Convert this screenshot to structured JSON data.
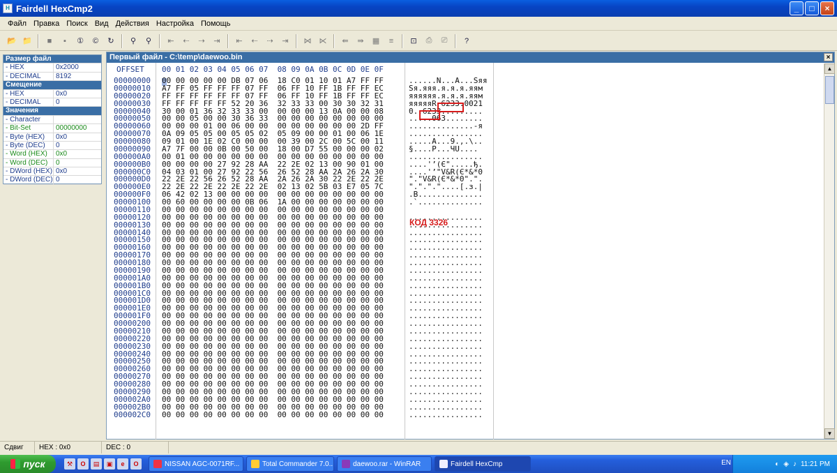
{
  "window": {
    "title": "Fairdell HexCmp2"
  },
  "menu": [
    "Файл",
    "Правка",
    "Поиск",
    "Вид",
    "Действия",
    "Настройка",
    "Помощь"
  ],
  "left_panel": [
    {
      "type": "header",
      "label": "Размер файл"
    },
    {
      "type": "row",
      "label": "- HEX",
      "value": "0x2000",
      "style": "blue"
    },
    {
      "type": "row",
      "label": "- DECIMAL",
      "value": "8192",
      "style": "blue"
    },
    {
      "type": "header",
      "label": "Смещение"
    },
    {
      "type": "row",
      "label": "- HEX",
      "value": "0x0",
      "style": "blue"
    },
    {
      "type": "row",
      "label": "- DECIMAL",
      "value": "0",
      "style": "blue"
    },
    {
      "type": "header",
      "label": "Значения"
    },
    {
      "type": "row",
      "label": "- Character",
      "value": "",
      "style": "blue"
    },
    {
      "type": "row",
      "label": "- Bit-Set",
      "value": "00000000",
      "style": "green"
    },
    {
      "type": "row",
      "label": "- Byte (HEX)",
      "value": "0x0",
      "style": "blue"
    },
    {
      "type": "row",
      "label": "- Byte (DEC)",
      "value": "0",
      "style": "blue"
    },
    {
      "type": "row",
      "label": "- Word (HEX)",
      "value": "0x0",
      "style": "green"
    },
    {
      "type": "row",
      "label": "- Word (DEC)",
      "value": "0",
      "style": "green"
    },
    {
      "type": "row",
      "label": "- DWord (HEX)",
      "value": "0x0",
      "style": "blue"
    },
    {
      "type": "row",
      "label": "- DWord (DEC)",
      "value": "0",
      "style": "blue"
    }
  ],
  "hex_panel": {
    "title": "Первый файл - C:\\temp\\daewoo.bin",
    "offset_header": "OFFSET",
    "column_header": "00 01 02 03 04 05 06 07  08 09 0A 0B 0C 0D 0E 0F",
    "rows": [
      {
        "o": "00000000",
        "h": "00 00 00 00 00 DB 07 06  18 C0 01 10 01 A7 FF FF",
        "a": "......N...A...Sяя"
      },
      {
        "o": "00000010",
        "h": "A7 FF 05 FF FF FF 07 FF  06 FF 10 FF 1B FF FF EC",
        "a": "Sя.яяя.я.я.я.яям"
      },
      {
        "o": "00000020",
        "h": "FF FF FF FF FF FF 07 FF  06 FF 10 FF 1B FF FF EC",
        "a": "яяяяяя.я.я.я.яям"
      },
      {
        "o": "00000030",
        "h": "FF FF FF FF FF 52 20 36  32 33 33 00 30 30 32 31",
        "a": "яяяяяR 6233.0021"
      },
      {
        "o": "00000040",
        "h": "30 00 01 36 32 33 33 00  00 00 00 13 0A 00 00 08",
        "a": "0..6233........."
      },
      {
        "o": "00000050",
        "h": "00 00 05 00 00 30 36 33  00 00 00 00 00 00 00 00",
        "a": ".....063........"
      },
      {
        "o": "00000060",
        "h": "00 00 00 01 00 06 00 00  00 00 00 00 00 00 2D FF",
        "a": "..............-я"
      },
      {
        "o": "00000070",
        "h": "0A 09 05 05 00 05 05 02  05 09 00 00 01 00 06 1E",
        "a": "................"
      },
      {
        "o": "00000080",
        "h": "09 01 00 1E 02 C0 00 00  00 39 00 2C 00 5C 00 11",
        "a": ".....A...9.,.\\.."
      },
      {
        "o": "00000090",
        "h": "A7 7F 00 00 0B 00 50 00  18 00 D7 55 00 00 00 02",
        "a": "§....P...ЧU...."
      },
      {
        "o": "000000A0",
        "h": "00 01 00 00 00 00 00 00  00 00 00 00 00 00 00 00",
        "a": "................"
      },
      {
        "o": "000000B0",
        "h": "00 00 00 00 27 92 28 AA  22 2E 02 13 00 90 01 00",
        "a": "....'’(Є\".....ђ."
      },
      {
        "o": "000000C0",
        "h": "04 03 01 00 27 92 22 56  26 52 28 AA 2A 26 2A 30",
        "a": "....'’\"V&R(Є*&*0"
      },
      {
        "o": "000000D0",
        "h": "22 2E 22 56 26 52 28 AA  2A 26 2A 30 22 2E 22 2E",
        "a": "\".\"V&R(Є*&*0\".\"."
      },
      {
        "o": "000000E0",
        "h": "22 2E 22 2E 22 2E 22 2E  02 13 02 5B 03 E7 05 7C",
        "a": "\".\".\".\"....[.з.|"
      },
      {
        "o": "000000F0",
        "h": "06 42 02 13 00 00 00 00  00 00 00 00 00 00 00 00",
        "a": ".B.............."
      },
      {
        "o": "00000100",
        "h": "00 60 00 00 00 00 0B 06  1A 00 00 00 00 00 00 00",
        "a": ".`.............."
      },
      {
        "o": "00000110",
        "h": "00 00 00 00 00 00 00 00  00 00 00 00 00 00 00 00",
        "a": ""
      },
      {
        "o": "00000120",
        "h": "00 00 00 00 00 00 00 00  00 00 00 00 00 00 00 00",
        "a": "................"
      },
      {
        "o": "00000130",
        "h": "00 00 00 00 00 00 00 00  00 00 00 00 00 00 00 00",
        "a": "................"
      },
      {
        "o": "00000140",
        "h": "00 00 00 00 00 00 00 00  00 00 00 00 00 00 00 00",
        "a": "................"
      },
      {
        "o": "00000150",
        "h": "00 00 00 00 00 00 00 00  00 00 00 00 00 00 00 00",
        "a": "................"
      },
      {
        "o": "00000160",
        "h": "00 00 00 00 00 00 00 00  00 00 00 00 00 00 00 00",
        "a": "................"
      },
      {
        "o": "00000170",
        "h": "00 00 00 00 00 00 00 00  00 00 00 00 00 00 00 00",
        "a": "................"
      },
      {
        "o": "00000180",
        "h": "00 00 00 00 00 00 00 00  00 00 00 00 00 00 00 00",
        "a": "................"
      },
      {
        "o": "00000190",
        "h": "00 00 00 00 00 00 00 00  00 00 00 00 00 00 00 00",
        "a": "................"
      },
      {
        "o": "000001A0",
        "h": "00 00 00 00 00 00 00 00  00 00 00 00 00 00 00 00",
        "a": "................"
      },
      {
        "o": "000001B0",
        "h": "00 00 00 00 00 00 00 00  00 00 00 00 00 00 00 00",
        "a": "................"
      },
      {
        "o": "000001C0",
        "h": "00 00 00 00 00 00 00 00  00 00 00 00 00 00 00 00",
        "a": "................"
      },
      {
        "o": "000001D0",
        "h": "00 00 00 00 00 00 00 00  00 00 00 00 00 00 00 00",
        "a": "................"
      },
      {
        "o": "000001E0",
        "h": "00 00 00 00 00 00 00 00  00 00 00 00 00 00 00 00",
        "a": "................"
      },
      {
        "o": "000001F0",
        "h": "00 00 00 00 00 00 00 00  00 00 00 00 00 00 00 00",
        "a": "................"
      },
      {
        "o": "00000200",
        "h": "00 00 00 00 00 00 00 00  00 00 00 00 00 00 00 00",
        "a": "................"
      },
      {
        "o": "00000210",
        "h": "00 00 00 00 00 00 00 00  00 00 00 00 00 00 00 00",
        "a": "................"
      },
      {
        "o": "00000220",
        "h": "00 00 00 00 00 00 00 00  00 00 00 00 00 00 00 00",
        "a": "................"
      },
      {
        "o": "00000230",
        "h": "00 00 00 00 00 00 00 00  00 00 00 00 00 00 00 00",
        "a": "................"
      },
      {
        "o": "00000240",
        "h": "00 00 00 00 00 00 00 00  00 00 00 00 00 00 00 00",
        "a": "................"
      },
      {
        "o": "00000250",
        "h": "00 00 00 00 00 00 00 00  00 00 00 00 00 00 00 00",
        "a": "................"
      },
      {
        "o": "00000260",
        "h": "00 00 00 00 00 00 00 00  00 00 00 00 00 00 00 00",
        "a": "................"
      },
      {
        "o": "00000270",
        "h": "00 00 00 00 00 00 00 00  00 00 00 00 00 00 00 00",
        "a": "................"
      },
      {
        "o": "00000280",
        "h": "00 00 00 00 00 00 00 00  00 00 00 00 00 00 00 00",
        "a": "................"
      },
      {
        "o": "00000290",
        "h": "00 00 00 00 00 00 00 00  00 00 00 00 00 00 00 00",
        "a": "................"
      },
      {
        "o": "000002A0",
        "h": "00 00 00 00 00 00 00 00  00 00 00 00 00 00 00 00",
        "a": "................"
      },
      {
        "o": "000002B0",
        "h": "00 00 00 00 00 00 00 00  00 00 00 00 00 00 00 00",
        "a": "................"
      },
      {
        "o": "000002C0",
        "h": "00 00 00 00 00 00 00 00  00 00 00 00 00 00 00 00",
        "a": "................"
      }
    ],
    "annotation": "КОД   3326",
    "annotation_color": "#d61b1b"
  },
  "status": {
    "mode": "Сдвиг",
    "hex": "HEX : 0x0",
    "dec": "DEC : 0"
  },
  "taskbar": {
    "start_label": "пуск",
    "tasks": [
      {
        "label": "NISSAN AGC-0071RF...",
        "active": false
      },
      {
        "label": "Total Commander 7.0...",
        "active": false
      },
      {
        "label": "daewoo.rar - WinRAR",
        "active": false
      },
      {
        "label": "Fairdell HexCmp",
        "active": true
      }
    ],
    "lang": "EN",
    "clock": "11:21 PM"
  }
}
